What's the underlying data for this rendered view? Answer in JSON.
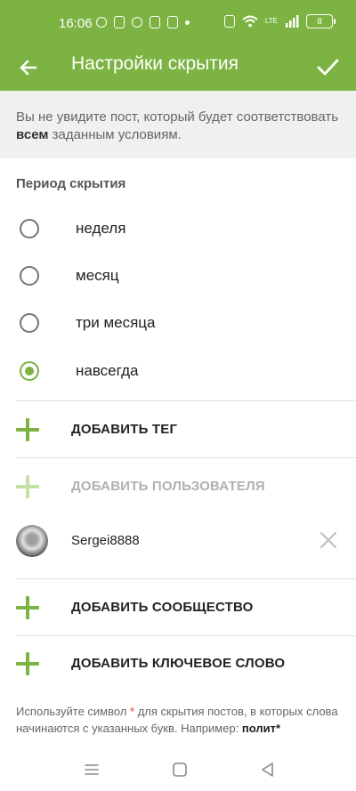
{
  "status_bar": {
    "time": "16:06",
    "battery": "8",
    "network": "LTE"
  },
  "app_bar": {
    "title": "Настройки скрытия"
  },
  "info": {
    "text_before": "Вы не увидите пост, который будет соответствовать ",
    "text_bold": "всем",
    "text_after": " заданным условиям."
  },
  "period": {
    "title": "Период скрытия",
    "options": [
      {
        "label": "неделя",
        "selected": false
      },
      {
        "label": "месяц",
        "selected": false
      },
      {
        "label": "три месяца",
        "selected": false
      },
      {
        "label": "навсегда",
        "selected": true
      }
    ]
  },
  "actions": {
    "add_tag": "ДОБАВИТЬ ТЕГ",
    "add_user": "ДОБАВИТЬ ПОЛЬЗОВАТЕЛЯ",
    "add_community": "ДОБАВИТЬ СООБЩЕСТВО",
    "add_keyword": "ДОБАВИТЬ КЛЮЧЕВОЕ СЛОВО"
  },
  "user": {
    "name": "Sergei8888"
  },
  "hint": {
    "before": "Используйте символ ",
    "star": "*",
    "middle": " для скрытия постов, в которых слова начинаются с указанных букв. Например: ",
    "example": "полит*"
  },
  "colors": {
    "accent": "#7cb342",
    "banner": "#f0f0f0"
  },
  "icons": {
    "back": "arrow-left-icon",
    "confirm": "check-icon",
    "add": "plus-icon",
    "remove": "close-icon"
  }
}
